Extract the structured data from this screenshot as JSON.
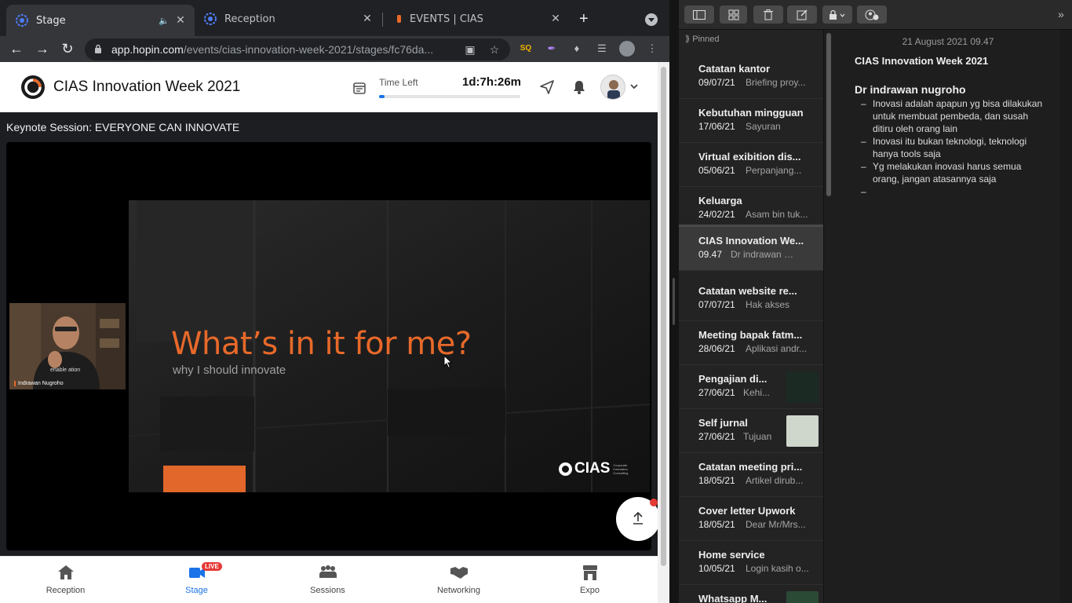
{
  "browser": {
    "tabs": [
      {
        "title": "Stage",
        "active": true
      },
      {
        "title": "Reception",
        "active": false
      },
      {
        "title": "EVENTS | CIAS",
        "active": false
      }
    ],
    "url_host": "app.hopin.com",
    "url_path": "/events/cias-innovation-week-2021/stages/fc76da..."
  },
  "app": {
    "event_title": "CIAS Innovation Week 2021",
    "time_left_label": "Time Left",
    "time_left_value": "1d:7h:26m",
    "time_left_progress": 0.04
  },
  "stage": {
    "session_title": "Keynote Session: EVERYONE CAN INNOVATE",
    "slide_headline": "What’s in it for me?",
    "slide_subtitle": "why I should innovate",
    "slide_brand": "CIAS",
    "slide_brand_tag": "Corporate Innovation Consulting",
    "speaker_name": "Indrawan Nugroho",
    "speaker_shirt_text": "enable ation"
  },
  "bottom_nav": [
    {
      "label": "Reception",
      "icon": "home-icon"
    },
    {
      "label": "Stage",
      "icon": "stage-icon",
      "badge": "LIVE",
      "active": true
    },
    {
      "label": "Sessions",
      "icon": "sessions-icon"
    },
    {
      "label": "Networking",
      "icon": "handshake-icon"
    },
    {
      "label": "Expo",
      "icon": "booth-icon"
    }
  ],
  "notes": {
    "pinned_label": "Pinned",
    "list": [
      {
        "title": "Catatan kantor",
        "date": "09/07/21",
        "preview": "Briefing proy..."
      },
      {
        "title": "Kebutuhan mingguan",
        "date": "17/06/21",
        "preview": "Sayuran"
      },
      {
        "title": "Virtual exibition dis...",
        "date": "05/06/21",
        "preview": "Perpanjang..."
      },
      {
        "title": "Keluarga",
        "date": "24/02/21",
        "preview": "Asam bin tuk..."
      },
      {
        "title": "CIAS Innovation We...",
        "date": "09.47",
        "preview": "Dr indrawan nu...",
        "selected": true
      },
      {
        "title": "Catatan website re...",
        "date": "07/07/21",
        "preview": "Hak akses"
      },
      {
        "title": "Meeting bapak fatm...",
        "date": "28/06/21",
        "preview": "Aplikasi andr..."
      },
      {
        "title": "Pengajian di...",
        "date": "27/06/21",
        "preview": "Kehi...",
        "thumb": true
      },
      {
        "title": "Self jurnal",
        "date": "27/06/21",
        "preview": "Tujuan",
        "thumb": true
      },
      {
        "title": "Catatan meeting pri...",
        "date": "18/05/21",
        "preview": "Artikel dirub..."
      },
      {
        "title": "Cover letter Upwork",
        "date": "18/05/21",
        "preview": "Dear Mr/Mrs..."
      },
      {
        "title": "Home service",
        "date": "10/05/21",
        "preview": "Login kasih o..."
      },
      {
        "title": "Whatsapp M...",
        "date": "",
        "preview": "",
        "thumb": true
      }
    ],
    "editor": {
      "date": "21 August 2021 09.47",
      "title": "CIAS Innovation Week 2021",
      "heading": "Dr indrawan nugroho",
      "bullets": [
        "Inovasi adalah apapun yg bisa dilakukan untuk membuat pembeda, dan susah ditiru oleh orang lain",
        "Inovasi itu bukan teknologi, teknologi hanya tools saja",
        "Yg melakukan inovasi harus semua orang, jangan atasannya saja",
        ""
      ]
    }
  },
  "colors": {
    "accent_orange": "#e8692a",
    "link_blue": "#1a73e8",
    "live_red": "#e53935"
  }
}
